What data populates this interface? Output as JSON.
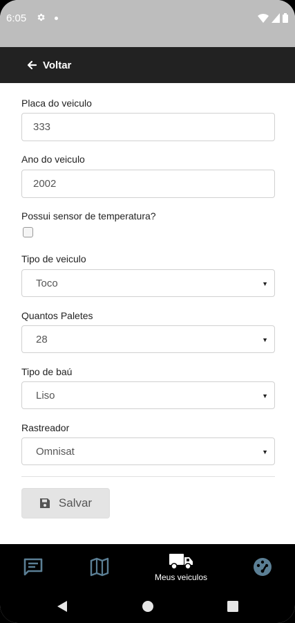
{
  "status_bar": {
    "time": "6:05",
    "icons": [
      "gear-icon",
      "notification-dot",
      "wifi-icon",
      "signal-icon",
      "battery-icon"
    ]
  },
  "header": {
    "back_label": "Voltar",
    "back_icon": "arrow-left-icon"
  },
  "form": {
    "plate": {
      "label": "Placa do veiculo",
      "value": "333"
    },
    "year": {
      "label": "Ano do veiculo",
      "value": "2002"
    },
    "sensor": {
      "label": "Possui sensor de temperatura?",
      "checked": false
    },
    "vehicle_type": {
      "label": "Tipo de veiculo",
      "value": "Toco"
    },
    "pallets": {
      "label": "Quantos Paletes",
      "value": "28"
    },
    "body_type": {
      "label": "Tipo de baú",
      "value": "Liso"
    },
    "tracker": {
      "label": "Rastreador",
      "value": "Omnisat"
    },
    "save_label": "Salvar"
  },
  "bottom_nav": {
    "items": [
      {
        "icon": "chat-icon",
        "label": ""
      },
      {
        "icon": "map-icon",
        "label": ""
      },
      {
        "icon": "truck-icon",
        "label": "Meus veiculos",
        "active": true
      },
      {
        "icon": "dashboard-icon",
        "label": ""
      }
    ]
  },
  "colors": {
    "app_bar": "#222222",
    "status_bar": "#bdbdbd",
    "nav_inactive": "#5b7f95",
    "nav_active": "#ffffff"
  }
}
